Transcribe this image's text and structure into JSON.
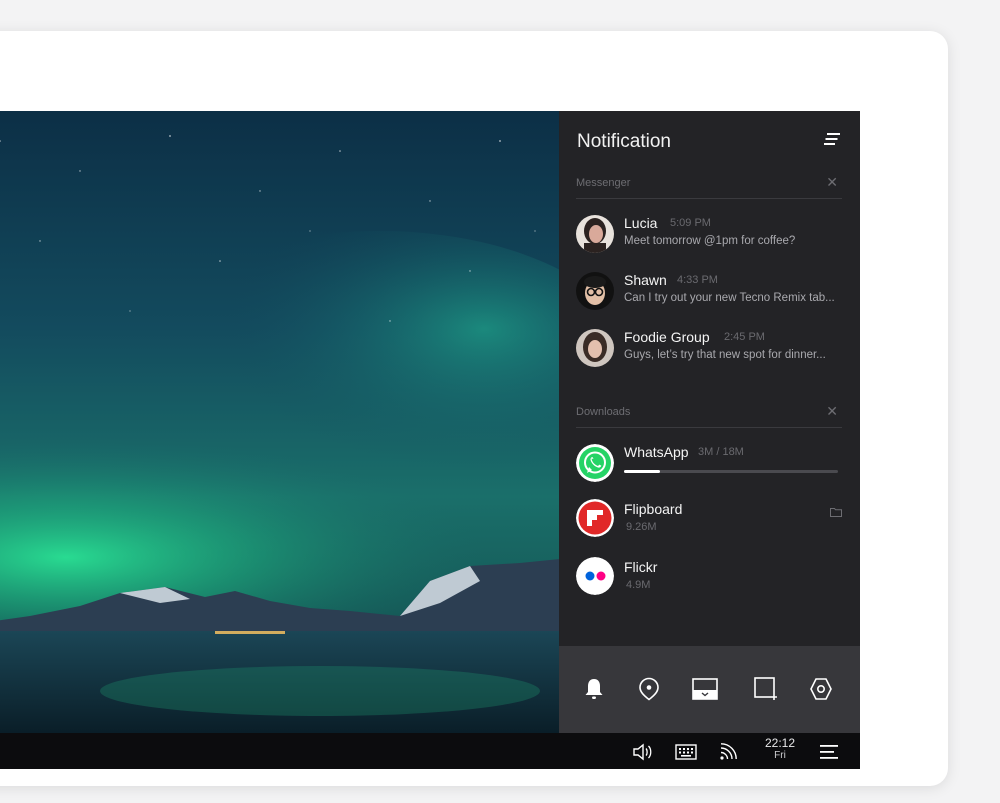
{
  "panel": {
    "title": "Notification",
    "messenger": {
      "label": "Messenger",
      "items": [
        {
          "name": "Lucia",
          "time": "5:09 PM",
          "text": "Meet tomorrow @1pm for coffee?"
        },
        {
          "name": "Shawn",
          "time": "4:33 PM",
          "text": "Can I try out your new Tecno Remix tab..."
        },
        {
          "name": "Foodie Group",
          "time": "2:45 PM",
          "text": "Guys, let’s try that new spot for dinner..."
        }
      ]
    },
    "downloads": {
      "label": "Downloads",
      "items": [
        {
          "name": "WhatsApp",
          "size": "3M / 18M",
          "progress": 0.17
        },
        {
          "name": "Flipboard",
          "size": "9.26M"
        },
        {
          "name": "Flickr",
          "size": "4.9M"
        }
      ]
    }
  },
  "quickbar": {
    "icons": [
      "bell-icon",
      "location-icon",
      "screen-icon",
      "screenshot-icon",
      "settings-icon"
    ]
  },
  "taskbar": {
    "icons": [
      "volume-icon",
      "keyboard-icon",
      "wifi-icon",
      "menu-icon"
    ],
    "time": "22:12",
    "day": "Fri"
  },
  "colors": {
    "panel_bg": "#232326",
    "quickbar_bg": "#37373b",
    "taskbar_bg": "#0c0c0e",
    "whatsapp": "#25d366",
    "flipboard": "#e12828",
    "flickr_blue": "#0063dc",
    "flickr_pink": "#ff0084"
  }
}
